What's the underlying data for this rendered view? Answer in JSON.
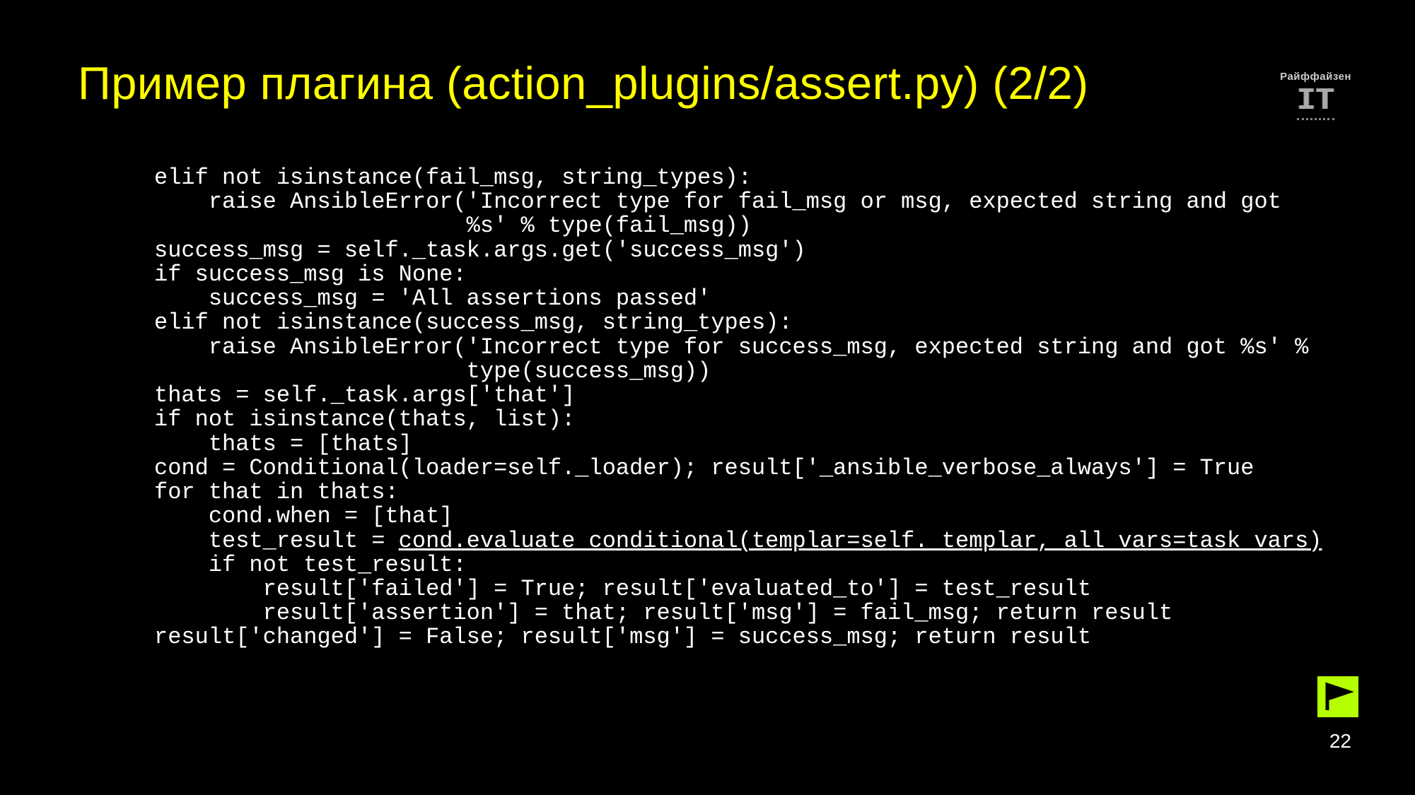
{
  "title": "Пример плагина (action_plugins/assert.py) (2/2)",
  "logo": {
    "brand": "Райффайзен",
    "it": "IT"
  },
  "page_number": "22",
  "code": {
    "l1": "elif not isinstance(fail_msg, string_types):",
    "l2": "    raise AnsibleError('Incorrect type for fail_msg or msg, expected string and got",
    "l3": "                       %s' % type(fail_msg))",
    "l4": "success_msg = self._task.args.get('success_msg')",
    "l5": "if success_msg is None:",
    "l6": "    success_msg = 'All assertions passed'",
    "l7": "elif not isinstance(success_msg, string_types):",
    "l8": "    raise AnsibleError('Incorrect type for success_msg, expected string and got %s' %",
    "l9": "                       type(success_msg))",
    "l10": "thats = self._task.args['that']",
    "l11": "if not isinstance(thats, list):",
    "l12": "    thats = [thats]",
    "l13": "cond = Conditional(loader=self._loader); result['_ansible_verbose_always'] = True",
    "l14": "for that in thats:",
    "l15": "    cond.when = [that]",
    "l16a": "    test_result = ",
    "l16b": "cond.evaluate_conditional(templar=self._templar, all_vars=task_vars)",
    "l17": "    if not test_result:",
    "l18": "        result['failed'] = True; result['evaluated_to'] = test_result",
    "l19": "        result['assertion'] = that; result['msg'] = fail_msg; return result",
    "l20": "result['changed'] = False; result['msg'] = success_msg; return result"
  }
}
